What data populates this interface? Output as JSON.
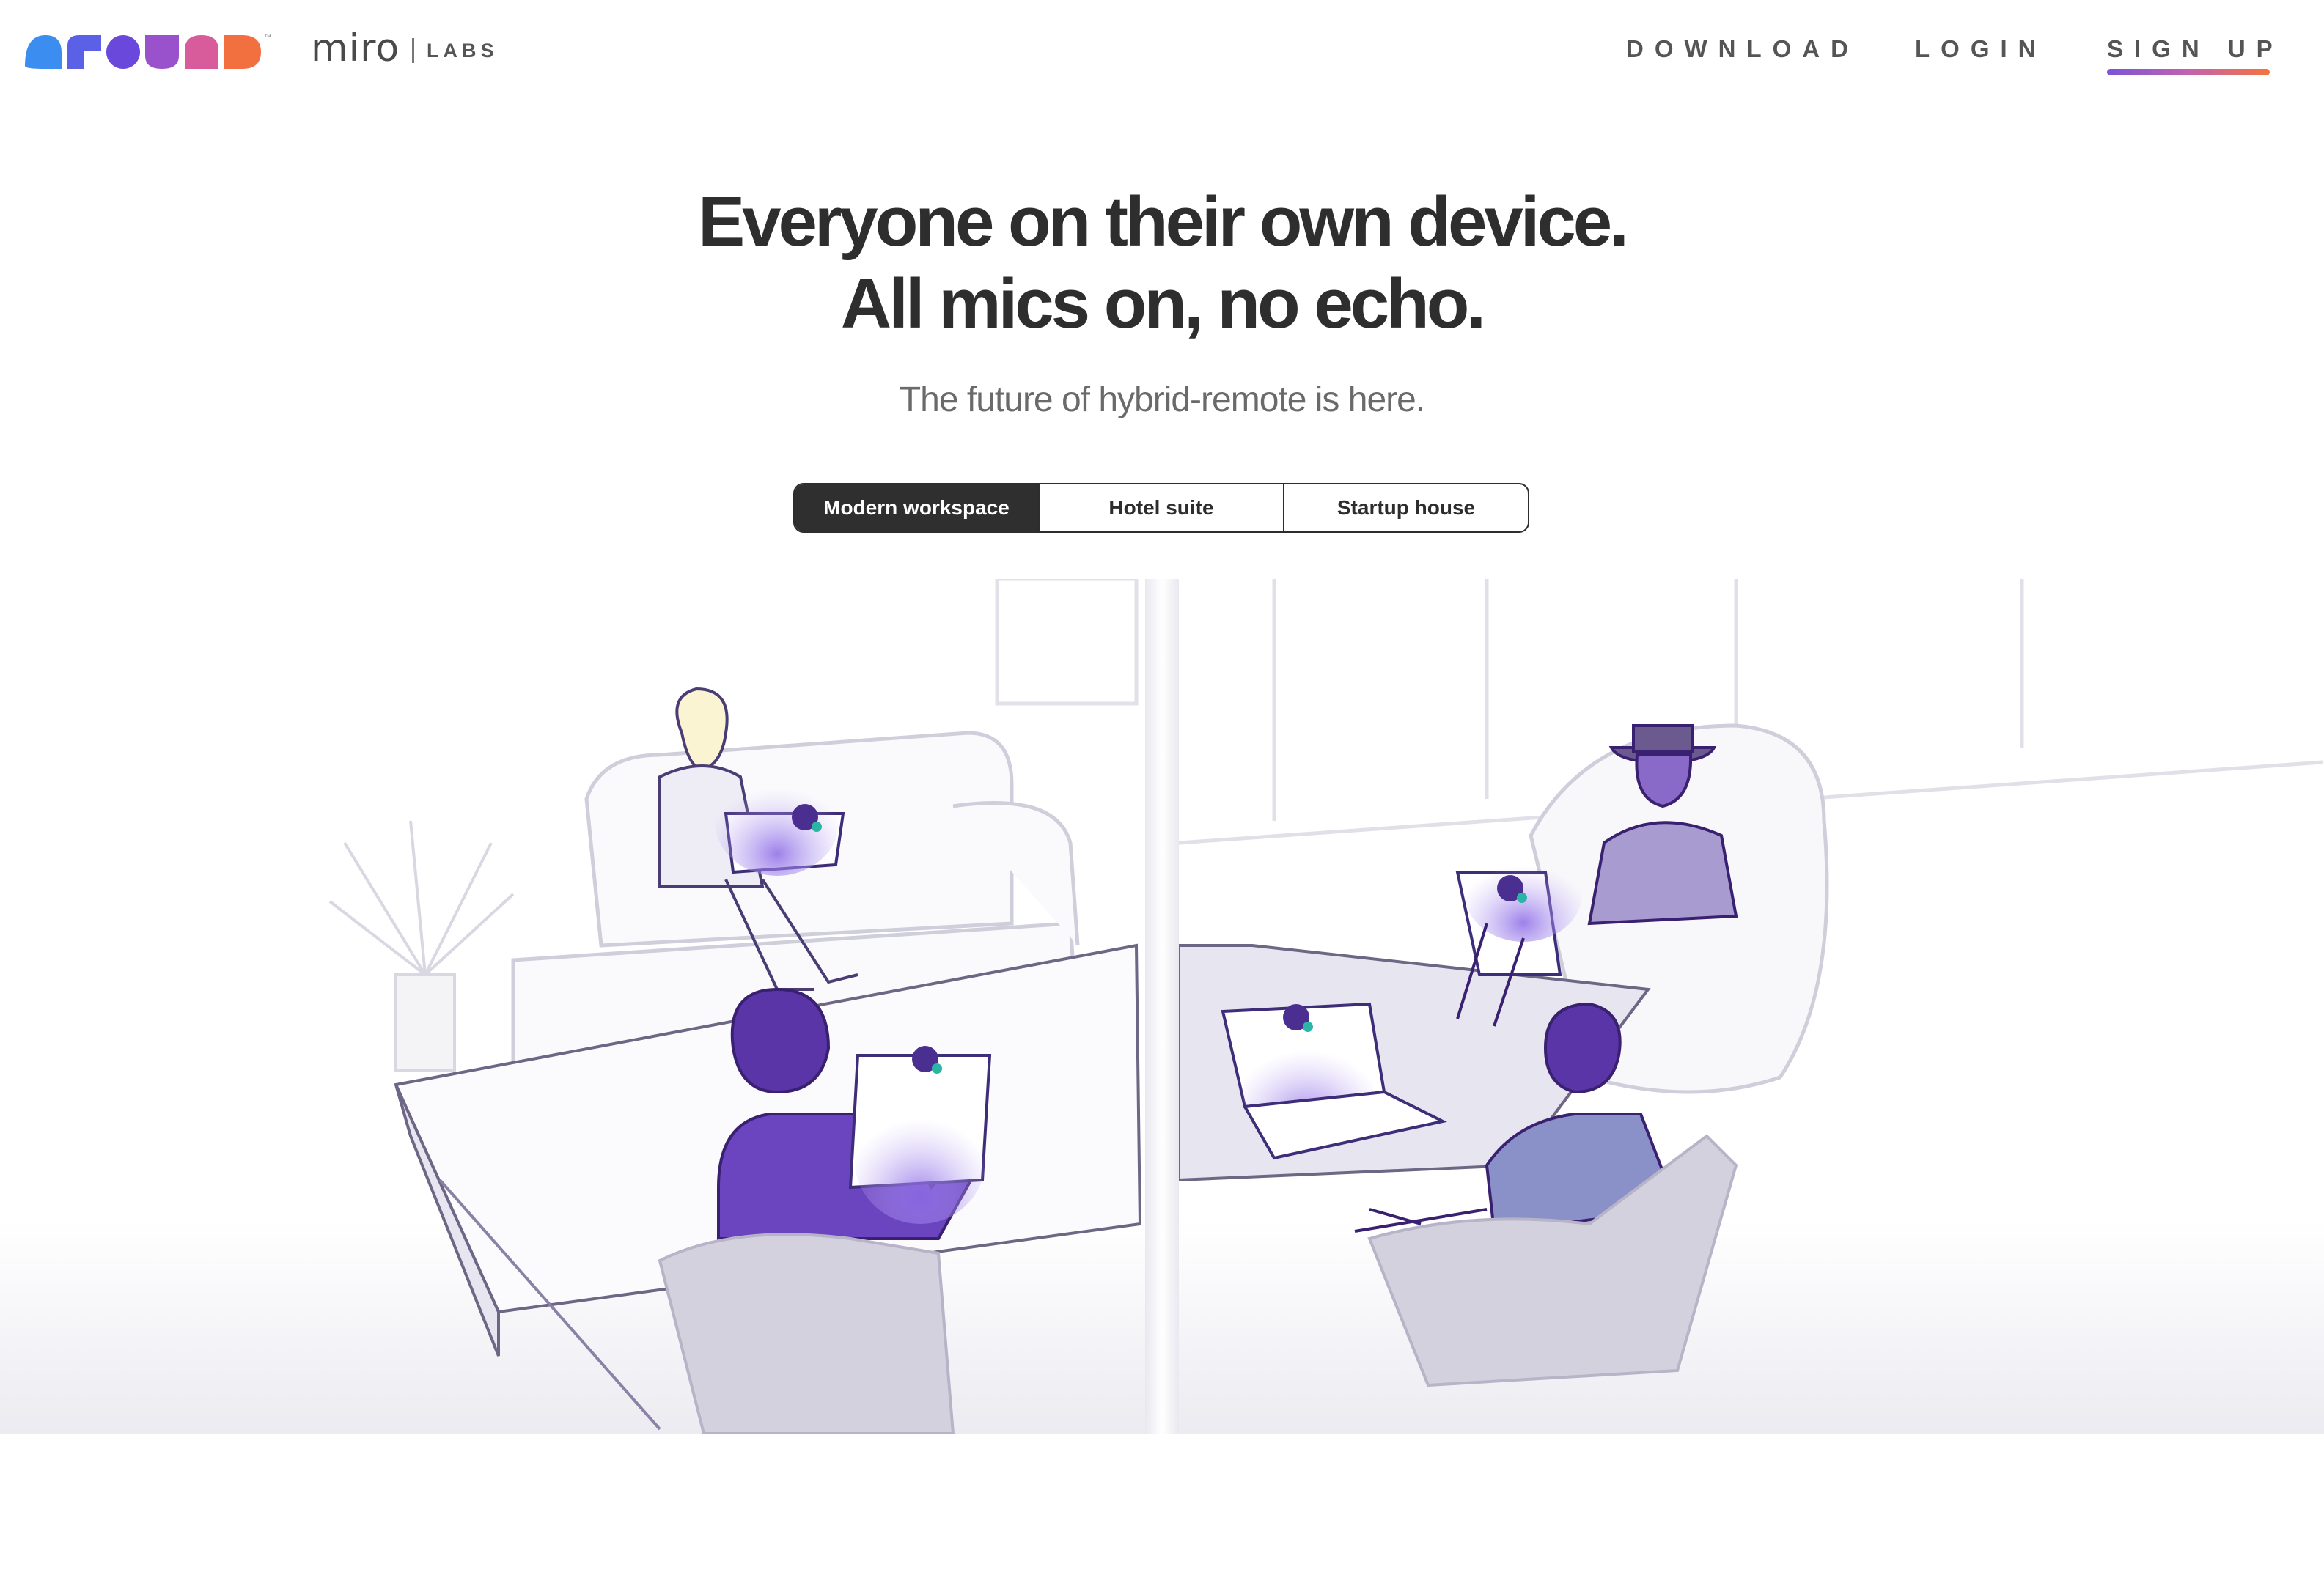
{
  "header": {
    "brand": "around",
    "brand_tm": "™",
    "partner": "miro",
    "partner_suffix": "LABS",
    "nav": {
      "download": "DOWNLOAD",
      "login": "LOGIN",
      "signup": "SIGN UP"
    }
  },
  "hero": {
    "headline_line1": "Everyone on their own device.",
    "headline_line2": "All mics on, no echo.",
    "subheadline": "The future of hybrid-remote is here."
  },
  "scene_switcher": {
    "options": [
      "Modern workspace",
      "Hotel suite",
      "Startup house"
    ],
    "selected": "Modern workspace"
  },
  "side_nav": {
    "icons": [
      "a-shape-icon",
      "r-shape-icon",
      "o-shape-icon",
      "u-shape-icon",
      "n-shape-icon",
      "d-shape-icon"
    ]
  },
  "colors": {
    "text_dark": "#2e2e2e",
    "accent_purple": "#6b3fc2",
    "gradient_start": "#7b53d8",
    "gradient_mid": "#c262b0",
    "gradient_end": "#f4733b",
    "mic_green": "#2ab5a5"
  }
}
